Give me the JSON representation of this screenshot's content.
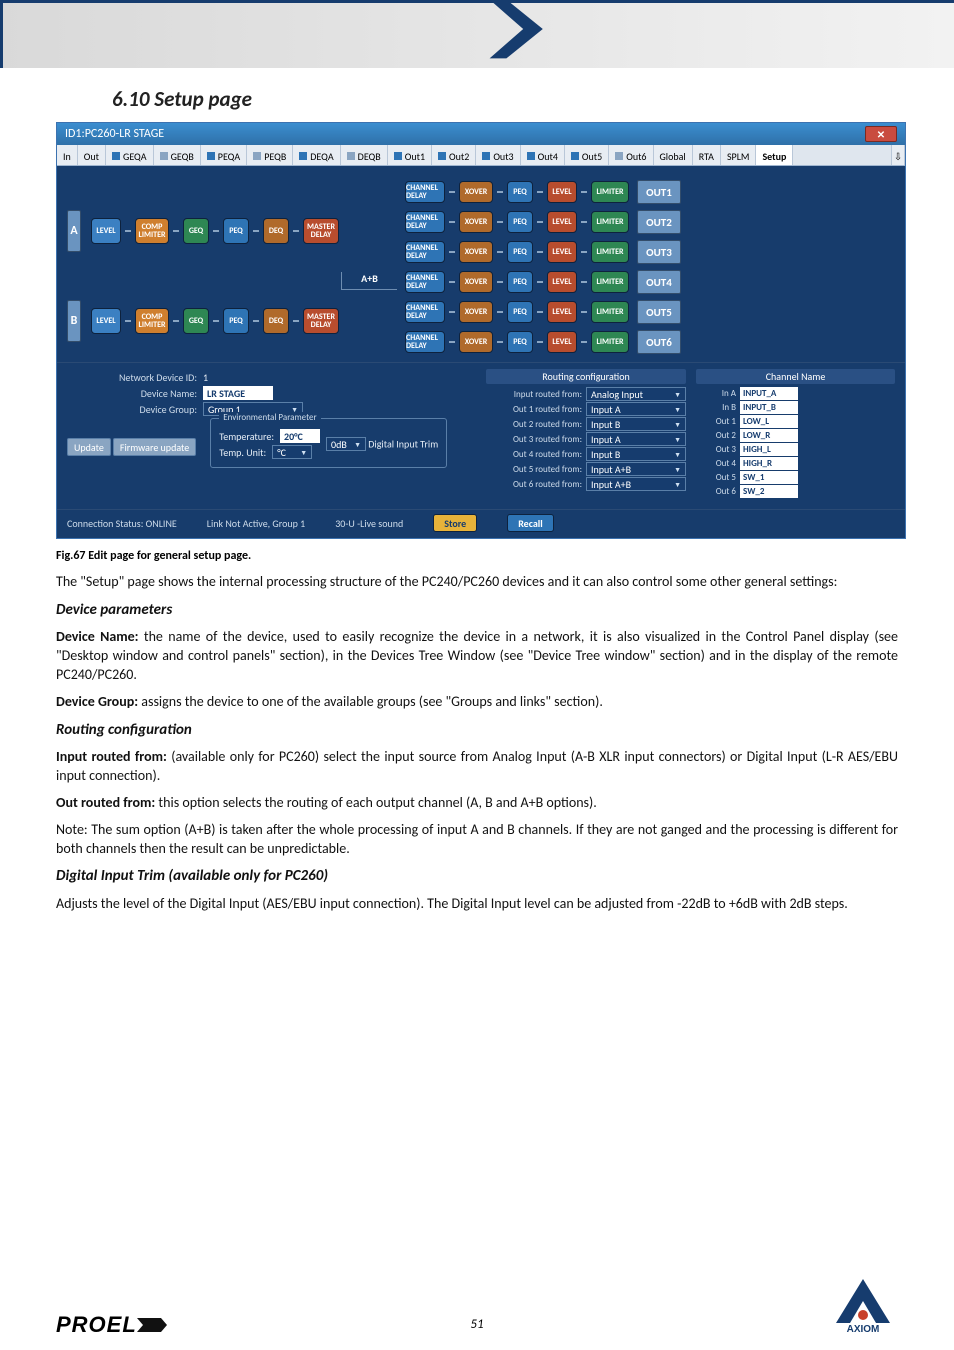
{
  "document": {
    "section_number": "6.10",
    "section_title": "Setup page",
    "caption": "Fig.67 Edit page for general setup page.",
    "page_number": "51",
    "footer_left": "PROEL",
    "footer_right": "AXIOM"
  },
  "window": {
    "title": "ID1:PC260-LR STAGE",
    "tabs": [
      "In",
      "Out",
      "GEQA",
      "GEQB",
      "PEQA",
      "PEQB",
      "DEQA",
      "DEQB",
      "Out1",
      "Out2",
      "Out3",
      "Out4",
      "Out5",
      "Out6",
      "Global",
      "RTA",
      "SPLM",
      "Setup"
    ],
    "active_tab": "Setup"
  },
  "diagram": {
    "inputs": [
      "A",
      "B"
    ],
    "input_blocks": [
      "LEVEL",
      "COMP\nLIMITER",
      "GEQ",
      "PEQ",
      "DEQ",
      "MASTER\nDELAY"
    ],
    "sum_label": "A+B",
    "output_blocks": [
      "CHANNEL\nDELAY",
      "XOVER",
      "PEQ",
      "LEVEL",
      "LIMITER"
    ],
    "outputs": [
      "OUT1",
      "OUT2",
      "OUT3",
      "OUT4",
      "OUT5",
      "OUT6"
    ]
  },
  "settings": {
    "network_id_label": "Network Device ID:",
    "network_id": "1",
    "device_name_label": "Device Name:",
    "device_name": "LR STAGE",
    "device_group_label": "Device Group:",
    "device_group": "Group 1",
    "update": "Update",
    "firmware": "Firmware update",
    "env_title": "Environmental Parameter",
    "temp_label": "Temperature:",
    "temp_value": "20°C",
    "temp_unit_label": "Temp. Unit:",
    "temp_unit": "°C",
    "dig_trim_label": "Digital Input Trim",
    "dig_trim_value": "0dB",
    "routing_title": "Routing configuration",
    "routing": [
      {
        "label": "Input routed from:",
        "value": "Analog Input"
      },
      {
        "label": "Out 1 routed from:",
        "value": "Input A"
      },
      {
        "label": "Out 2 routed from:",
        "value": "Input B"
      },
      {
        "label": "Out 3 routed from:",
        "value": "Input A"
      },
      {
        "label": "Out 4 routed from:",
        "value": "Input B"
      },
      {
        "label": "Out 5 routed from:",
        "value": "Input A+B"
      },
      {
        "label": "Out 6 routed from:",
        "value": "Input A+B"
      }
    ],
    "chname_title": "Channel Name",
    "chnames": [
      {
        "label": "In A",
        "value": "INPUT_A"
      },
      {
        "label": "In B",
        "value": "INPUT_B"
      },
      {
        "label": "Out 1",
        "value": "LOW_L"
      },
      {
        "label": "Out 2",
        "value": "LOW_R"
      },
      {
        "label": "Out 3",
        "value": "HIGH_L"
      },
      {
        "label": "Out 4",
        "value": "HIGH_R"
      },
      {
        "label": "Out 5",
        "value": "SW_1"
      },
      {
        "label": "Out 6",
        "value": "SW_2"
      }
    ]
  },
  "statusbar": {
    "conn": "Connection Status: ONLINE",
    "link": "Link Not Active,  Group 1",
    "preset": "30-U -Live sound",
    "store": "Store",
    "recall": "Recall"
  },
  "body": {
    "p1": "The \"Setup\" page shows the internal processing structure of the PC240/PC260 devices and it can also control some other general settings:",
    "h_devparams": "Device parameters",
    "devname_b": "Device Name:",
    "devname_t": " the name of the device, used to easily recognize the device in a network, it is also visualized in the Control Panel display (see \"Desktop window and control panels\" section), in the Devices Tree Window (see \"Device Tree window\" section) and in the display of the remote PC240/PC260.",
    "devgroup_b": "Device Group:",
    "devgroup_t": " assigns the device to one of the available groups (see \"Groups and links\" section).",
    "h_routing": "Routing configuration",
    "inrouted_b": "Input routed from:",
    "inrouted_t": " (available only for PC260) select the input source from Analog Input (A-B XLR input connectors) or Digital Input (L-R AES/EBU input connection).",
    "outrouted_b": "Out routed from:",
    "outrouted_t": " this option selects the routing of each output channel (A, B and A+B options).",
    "note": "Note: The sum option (A+B) is taken after the whole processing of input A and B channels. If they are not ganged and the processing is different for both channels then the result can be unpredictable.",
    "h_dig": "Digital Input Trim ",
    "h_dig2": "(available only for PC260)",
    "dig_t": "Adjusts the level of the Digital Input (AES/EBU input connection). The Digital Input level can be adjusted from -22dB to +6dB with 2dB steps."
  }
}
